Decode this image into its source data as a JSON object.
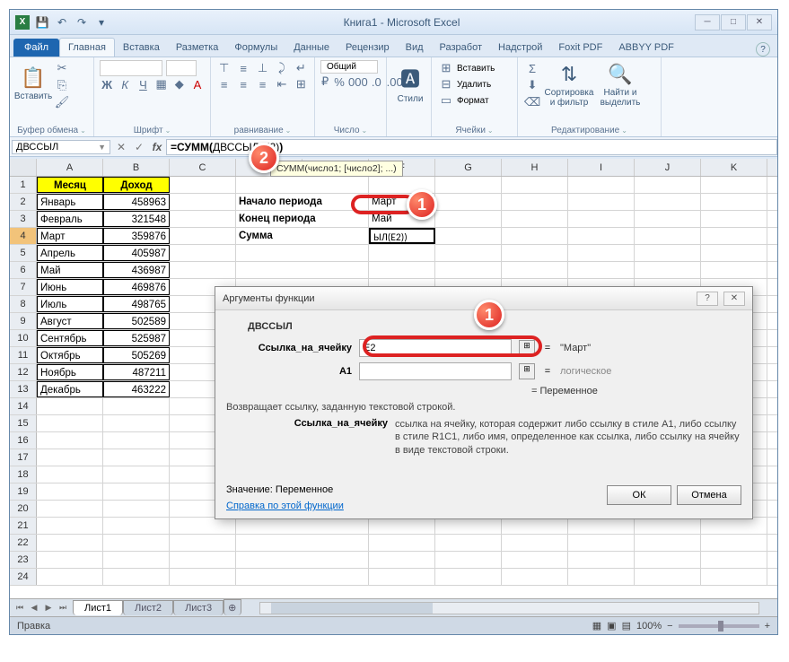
{
  "title": "Книга1  -  Microsoft Excel",
  "qat": {
    "excel": "X",
    "save": "💾",
    "undo": "↶",
    "redo": "↷"
  },
  "ribbon_tabs": {
    "file": "Файл",
    "home": "Главная",
    "insert": "Вставка",
    "layout": "Разметка",
    "formulas": "Формулы",
    "data": "Данные",
    "review": "Рецензир",
    "view": "Вид",
    "dev": "Разработ",
    "addins": "Надстрой",
    "foxit": "Foxit PDF",
    "abbyy": "ABBYY PDF"
  },
  "ribbon_groups": {
    "clipboard": {
      "label": "Буфер обмена",
      "paste": "Вставить"
    },
    "font": {
      "label": "Шрифт"
    },
    "align": {
      "label": "равнивание"
    },
    "number": {
      "label": "Число",
      "format": "Общий"
    },
    "styles": {
      "label": "",
      "btn": "Стили"
    },
    "cells": {
      "label": "Ячейки",
      "insert": "Вставить",
      "delete": "Удалить",
      "format": "Формат"
    },
    "editing": {
      "label": "Редактирование",
      "sort": "Сортировка\nи фильтр",
      "find": "Найти и\nвыделить"
    }
  },
  "namebox": "ДВССЫЛ",
  "formula": {
    "pre": "=СУММ(",
    "inner": "ДВССЫЛ(E2)",
    "post": ")"
  },
  "formula_tip": "СУММ(число1; [число2]; ...)",
  "columns": [
    "A",
    "B",
    "C",
    "D",
    "E",
    "F",
    "G",
    "H",
    "I",
    "J",
    "K"
  ],
  "headers": {
    "month": "Месяц",
    "income": "Доход"
  },
  "months": [
    "Январь",
    "Февраль",
    "Март",
    "Апрель",
    "Май",
    "Июнь",
    "Июль",
    "Август",
    "Сентябрь",
    "Октябрь",
    "Ноябрь",
    "Декабрь"
  ],
  "values": [
    "458963",
    "321548",
    "359876",
    "405987",
    "436987",
    "469876",
    "498765",
    "502589",
    "525987",
    "505269",
    "487211",
    "463222"
  ],
  "side": {
    "start_label": "Начало периода",
    "start_val": "Март",
    "end_label": "Конец периода",
    "end_val": "Май",
    "sum_label": "Сумма",
    "sum_val": "ЫЛ(E2))"
  },
  "dialog": {
    "title": "Аргументы функции",
    "fname": "ДВССЫЛ",
    "arg1_label": "Ссылка_на_ячейку",
    "arg1_val": "E2",
    "arg1_result": "\"Март\"",
    "arg2_label": "A1",
    "arg2_val": "",
    "arg2_result": "логическое",
    "eq": "=",
    "result2": "Переменное",
    "desc": "Возвращает ссылку, заданную текстовой строкой.",
    "argdesc_label": "Ссылка_на_ячейку",
    "argdesc_text": "ссылка на ячейку, которая содержит либо ссылку в стиле A1, либо ссылку в стиле R1C1, либо имя, определенное как ссылка, либо ссылку на ячейку в виде текстовой строки.",
    "value_label": "Значение:",
    "value_val": "Переменное",
    "help": "Справка по этой функции",
    "ok": "ОК",
    "cancel": "Отмена"
  },
  "sheets": {
    "s1": "Лист1",
    "s2": "Лист2",
    "s3": "Лист3"
  },
  "status": {
    "mode": "Правка",
    "zoom": "100%"
  },
  "badges": {
    "b1": "1",
    "b2": "2"
  }
}
